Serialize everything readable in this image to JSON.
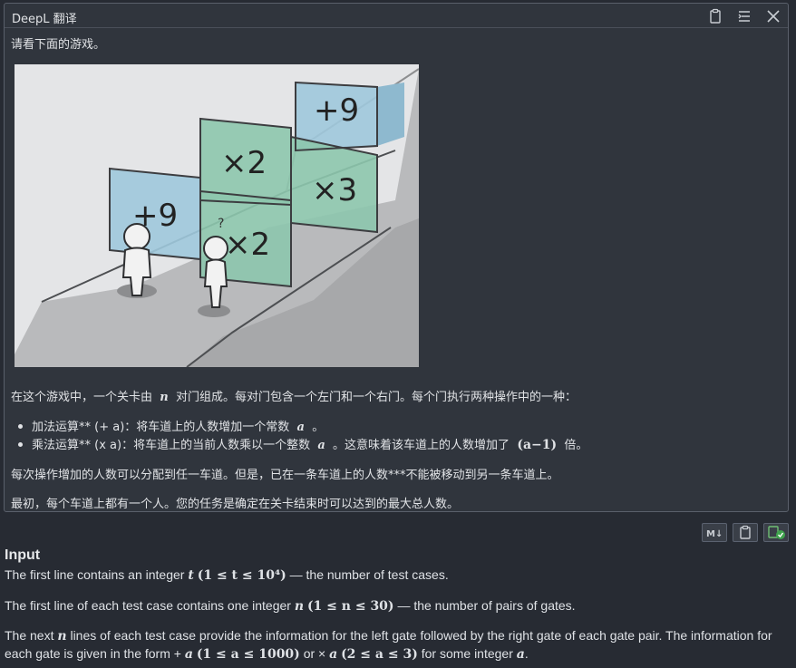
{
  "window": {
    "title": "DeepL 翻译",
    "icons": [
      "clipboard-icon",
      "menu-icon",
      "close-icon"
    ]
  },
  "translation": {
    "intro": "请看下面的游戏。",
    "image": {
      "gate_labels": [
        "+9",
        "×2",
        "×3",
        "+9",
        "×2"
      ],
      "question_mark": "?"
    },
    "para1_before": "在这个游戏中，一个关卡由",
    "para1_var": "n",
    "para1_after": "对门组成。每对门包含一个左门和一个右门。每个门执行两种操作中的一种：",
    "bullet1_before": "加法运算** (+ a)：将车道上的人数增加一个常数",
    "bullet1_var": "a",
    "bullet1_after": "。",
    "bullet2_before": "乘法运算** (x a)：将车道上的当前人数乘以一个整数",
    "bullet2_var": "a",
    "bullet2_mid": "。这意味着该车道上的人数增加了",
    "bullet2_expr": "(a−1)",
    "bullet2_after": "倍。",
    "para2": "每次操作增加的人数可以分配到任一车道。但是，已在一条车道上的人数***不能被移动到另一条车道上。",
    "para3": "最初，每个车道上都有一个人。您的任务是确定在关卡结束时可以达到的最大总人数。"
  },
  "actions": {
    "markdown_label": "M↓",
    "icons": [
      "markdown-icon",
      "copy-icon",
      "translate-ok-icon"
    ]
  },
  "problem": {
    "heading": "Input",
    "line1_a": "The first line contains an integer",
    "line1_var": "t",
    "line1_range": "(1 ≤ t ≤ 10⁴)",
    "line1_b": "— the number of test cases.",
    "line2_a": "The first line of each test case contains one integer",
    "line2_var": "n",
    "line2_range": "(1 ≤ n ≤ 30)",
    "line2_b": "— the number of pairs of gates.",
    "line3_a": "The next",
    "line3_var": "n",
    "line3_b": "lines of each test case provide the information for the left gate followed by the right gate of each gate pair. The information for",
    "line4_a": "each gate is given in the form +",
    "line4_var1": "a",
    "line4_range1": "(1 ≤ a ≤ 1000)",
    "line4_b": "or ×",
    "line4_var2": "a",
    "line4_range2": "(2 ≤ a ≤ 3)",
    "line4_c": "for some integer",
    "line4_var3": "a",
    "line4_d": "."
  }
}
